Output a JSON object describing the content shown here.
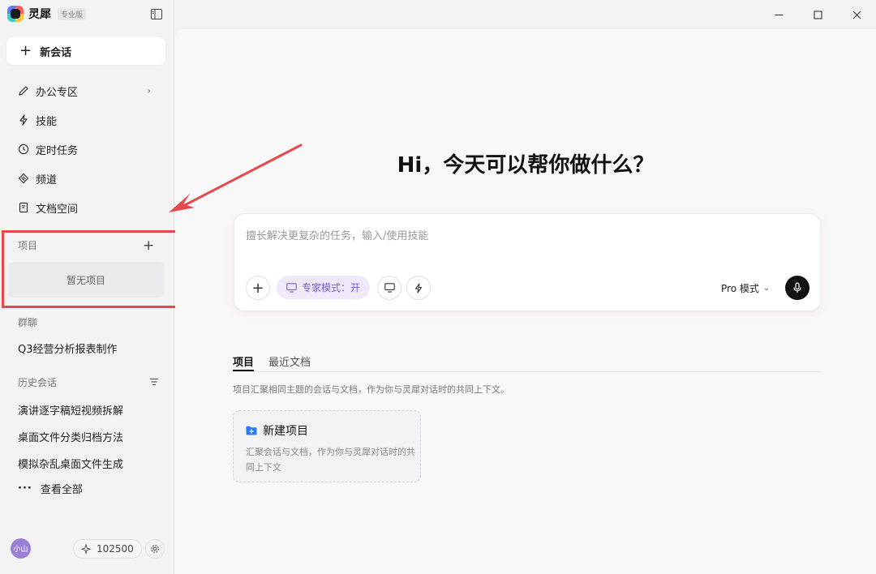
{
  "app": {
    "name": "灵犀",
    "edition": "专业版"
  },
  "sidebar": {
    "new_chat": "新会话",
    "nav": [
      {
        "label": "办公专区",
        "icon": "pencil-icon"
      },
      {
        "label": "技能",
        "icon": "lightning-icon"
      },
      {
        "label": "定时任务",
        "icon": "clock-icon"
      },
      {
        "label": "频道",
        "icon": "channel-icon"
      },
      {
        "label": "文档空间",
        "icon": "document-icon"
      }
    ],
    "projects": {
      "label": "项目",
      "empty": "暂无项目"
    },
    "groups": {
      "label": "群聊",
      "items": [
        "Q3经营分析报表制作"
      ]
    },
    "history": {
      "label": "历史会话",
      "items": [
        "演讲逐字稿短视频拆解",
        "桌面文件分类归档方法",
        "模拟杂乱桌面文件生成"
      ],
      "see_all": "查看全部"
    },
    "user": {
      "avatar_text": "小山",
      "credits": "102500"
    }
  },
  "main": {
    "headline": "Hi，今天可以帮你做什么？",
    "input": {
      "placeholder": "擅长解决更复杂的任务，输入/使用技能",
      "value": "",
      "expert_mode": "专家模式：开",
      "mode": "Pro 模式"
    },
    "tabs": [
      {
        "label": "项目",
        "active": true
      },
      {
        "label": "最近文档",
        "active": false
      }
    ],
    "description": "项目汇聚相同主题的会话与文档，作为你与灵犀对话时的共同上下文。",
    "new_project": {
      "title": "新建项目",
      "desc": "汇聚会话与文档，作为你与灵犀对话时的共同上下文"
    }
  },
  "colors": {
    "accent_purple": "#7a5bd6",
    "highlight_red": "#e5484d",
    "folder_blue": "#2f7bf5"
  }
}
